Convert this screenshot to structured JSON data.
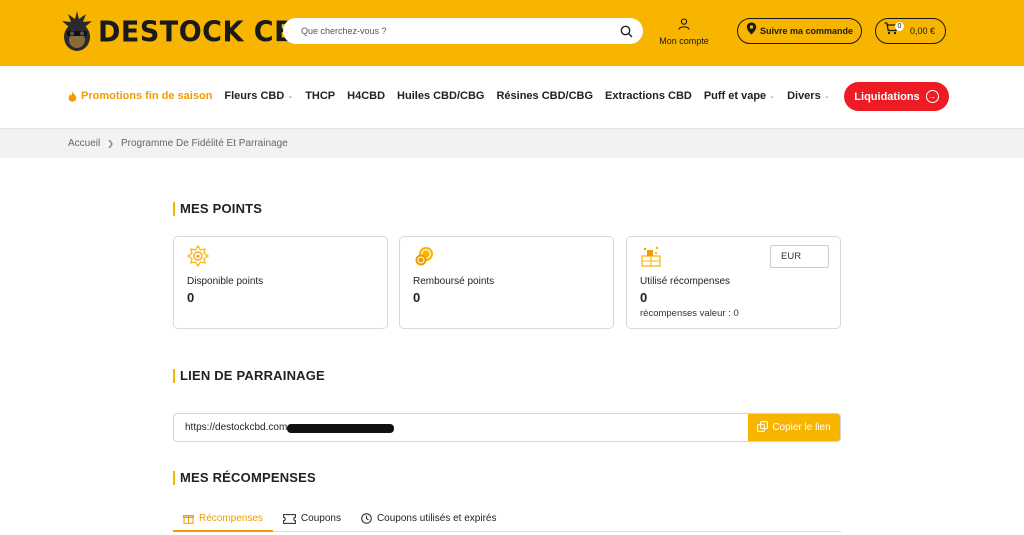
{
  "header": {
    "logo_text": "DESTOCK CBD",
    "search_placeholder": "Que cherchez-vous ?",
    "account_label": "Mon compte",
    "track_order_label": "Suivre ma commande",
    "cart_count": "0",
    "cart_total": "0,00 €"
  },
  "nav": {
    "items": [
      {
        "label": "Promotions fin de saison",
        "dropdown": false,
        "highlight": true
      },
      {
        "label": "Fleurs CBD",
        "dropdown": true
      },
      {
        "label": "THCP",
        "dropdown": false
      },
      {
        "label": "H4CBD",
        "dropdown": false
      },
      {
        "label": "Huiles CBD/CBG",
        "dropdown": false
      },
      {
        "label": "Résines CBD/CBG",
        "dropdown": false
      },
      {
        "label": "Extractions CBD",
        "dropdown": false
      },
      {
        "label": "Puff et vape",
        "dropdown": true
      },
      {
        "label": "Divers",
        "dropdown": true
      }
    ],
    "liquidations_label": "Liquidations"
  },
  "breadcrumb": {
    "home": "Accueil",
    "current": "Programme De Fidélité Et Parrainage"
  },
  "points": {
    "title": "MES POINTS",
    "cards": [
      {
        "label": "Disponible points",
        "value": "0"
      },
      {
        "label": "Remboursé points",
        "value": "0"
      },
      {
        "label": "Utilisé récompenses",
        "value": "0",
        "sub": "récompenses valeur : 0",
        "currency": "EUR"
      }
    ]
  },
  "referral": {
    "title": "LIEN DE PARRAINAGE",
    "url_visible": "https://destockcbd.com",
    "copy_label": "Copier le lien"
  },
  "rewards": {
    "title": "MES RÉCOMPENSES",
    "tabs": [
      {
        "label": "Récompenses",
        "active": true
      },
      {
        "label": "Coupons",
        "active": false
      },
      {
        "label": "Coupons utilisés et expirés",
        "active": false
      }
    ]
  },
  "colors": {
    "brand_yellow": "#f7b500",
    "accent_orange": "#f29b00",
    "liquidation_red": "#ee1b24"
  },
  "icons": [
    "logo-monkey-icon",
    "search-icon",
    "user-icon",
    "location-pin-icon",
    "cart-icon",
    "fire-icon",
    "arrow-right-circle-icon",
    "points-badge-icon",
    "coins-icon",
    "reward-box-icon",
    "copy-icon",
    "gift-icon",
    "ticket-icon",
    "clock-icon"
  ]
}
